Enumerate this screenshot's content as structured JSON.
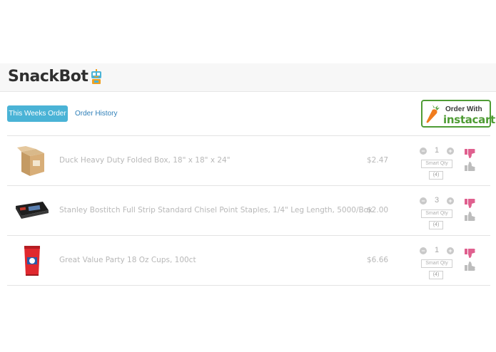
{
  "brand": {
    "name": "SnackBot"
  },
  "tabs": {
    "active": "This Weeks Order",
    "other": "Order History"
  },
  "instacart": {
    "line1": "Order With",
    "line2": "instacart"
  },
  "colors": {
    "accent": "#4ab3d6",
    "instacart_green": "#4f9c35",
    "thumbs_down": "#e0608f",
    "thumbs_up": "#bdbdbd"
  },
  "items": [
    {
      "name": "Duck Heavy Duty Folded Box, 18\" x 18\" x 24\"",
      "price": "$2.47",
      "qty": "1",
      "smart_label": "Smart Qty",
      "smart_qty": "(4)",
      "image": "cardboard-box"
    },
    {
      "name": "Stanley Bostitch Full Strip Standard Chisel Point Staples, 1/4\" Leg Length, 5000/Box",
      "price": "$2.00",
      "qty": "3",
      "smart_label": "Smart Qty",
      "smart_qty": "(4)",
      "image": "staples-box"
    },
    {
      "name": "Great Value Party 18 Oz Cups, 100ct",
      "price": "$6.66",
      "qty": "1",
      "smart_label": "Smart Qty",
      "smart_qty": "(4)",
      "image": "red-cups"
    }
  ]
}
